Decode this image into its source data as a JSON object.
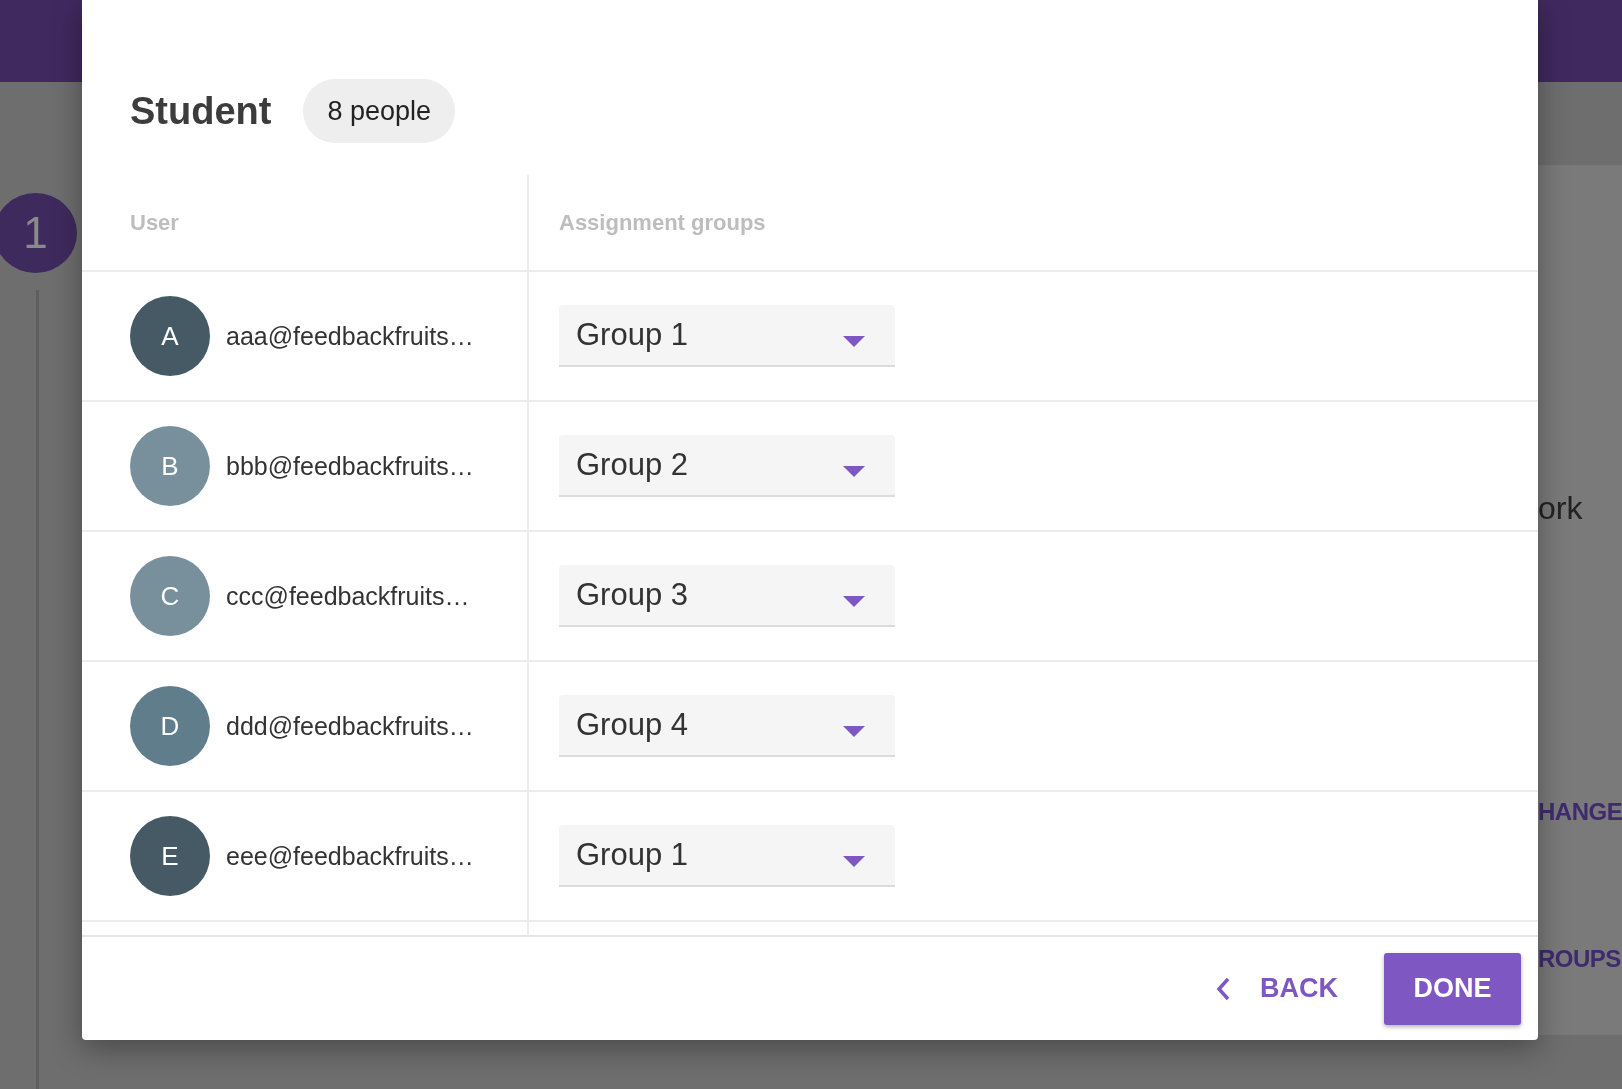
{
  "background": {
    "step_number": "1",
    "texts": [
      {
        "kind": "text",
        "text": "ork"
      },
      {
        "kind": "action",
        "text": "HANGE"
      },
      {
        "kind": "action",
        "text": "ROUPS"
      }
    ]
  },
  "dialog": {
    "title": "Student",
    "count": "8 people",
    "columns": [
      "User",
      "Assignment groups"
    ],
    "rows": [
      {
        "avatar": "A",
        "color": "#455a64",
        "email": "aaa@feedbackfruits…",
        "group": "Group 1"
      },
      {
        "avatar": "B",
        "color": "#78909c",
        "email": "bbb@feedbackfruits…",
        "group": "Group 2"
      },
      {
        "avatar": "C",
        "color": "#78909c",
        "email": "ccc@feedbackfruits…",
        "group": "Group 3"
      },
      {
        "avatar": "D",
        "color": "#607d8b",
        "email": "ddd@feedbackfruits…",
        "group": "Group 4"
      },
      {
        "avatar": "E",
        "color": "#455a64",
        "email": "eee@feedbackfruits…",
        "group": "Group 1"
      }
    ],
    "back": "BACK",
    "done": "DONE"
  }
}
